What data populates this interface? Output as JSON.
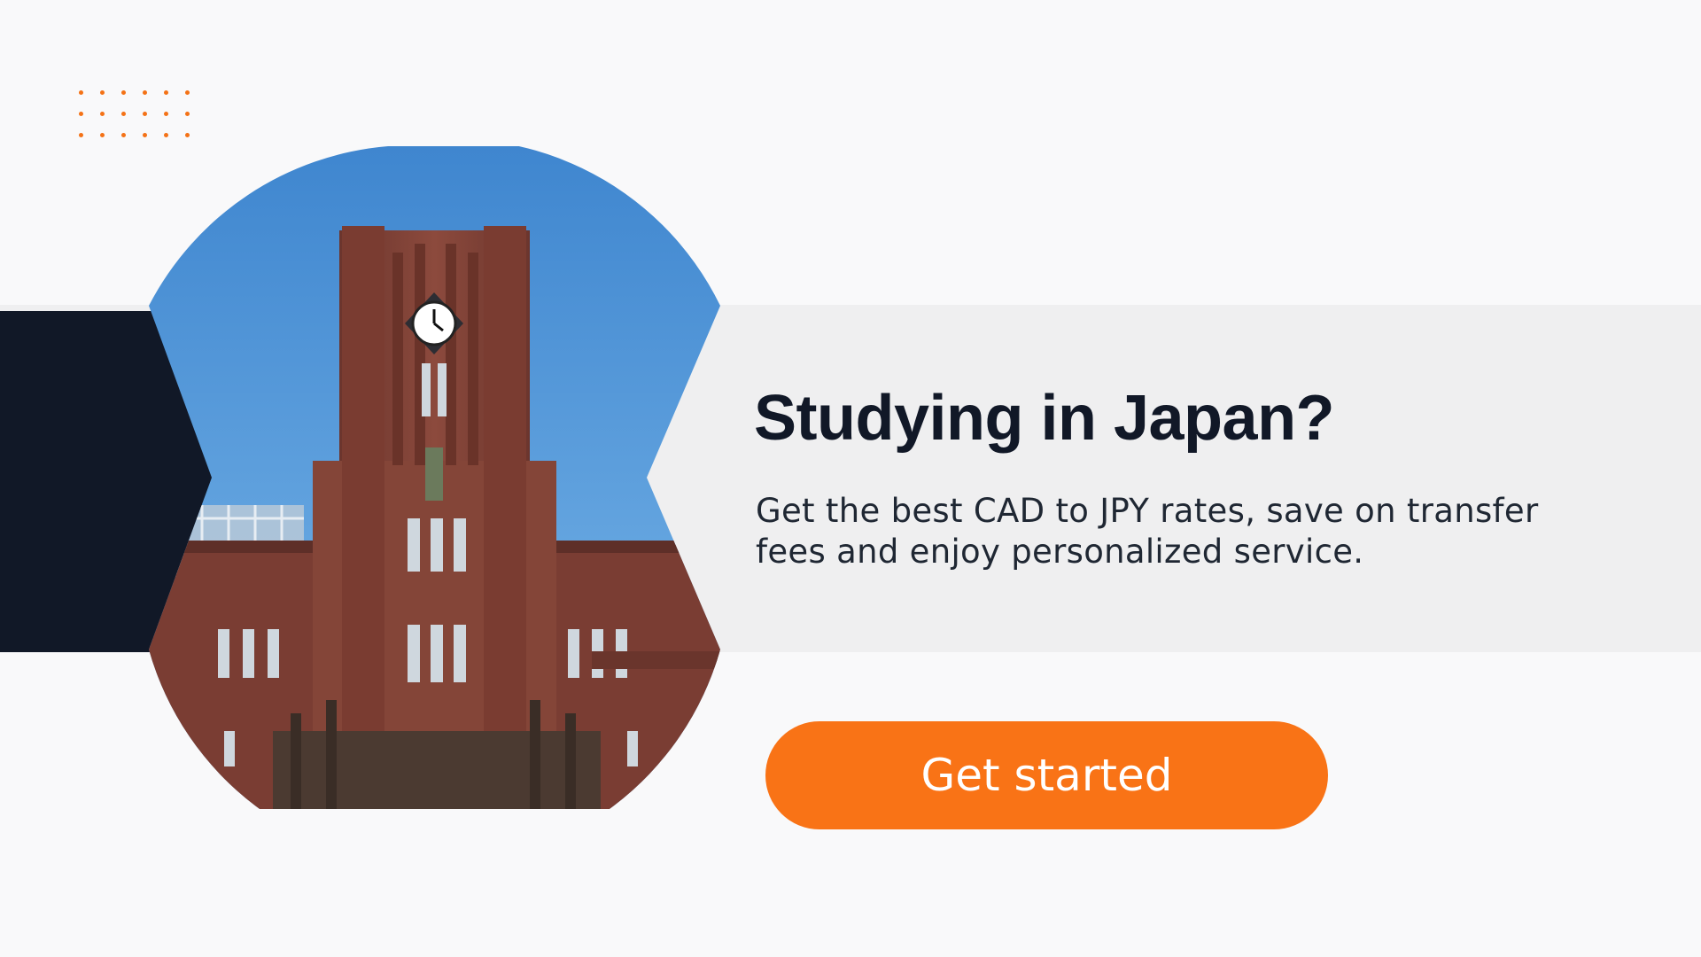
{
  "hero": {
    "headline": "Studying in Japan?",
    "subtext": "Get the best CAD to JPY rates, save on transfer fees and enjoy personalized service.",
    "cta_label": "Get started",
    "photo": "university-clock-tower-photo"
  },
  "colors": {
    "background": "#f9f9fa",
    "band": "#efeff0",
    "navy": "#111827",
    "accent": "#f97316",
    "dots": "#f47216"
  },
  "decor": {
    "dot_pattern": "dot-grid-icon"
  }
}
